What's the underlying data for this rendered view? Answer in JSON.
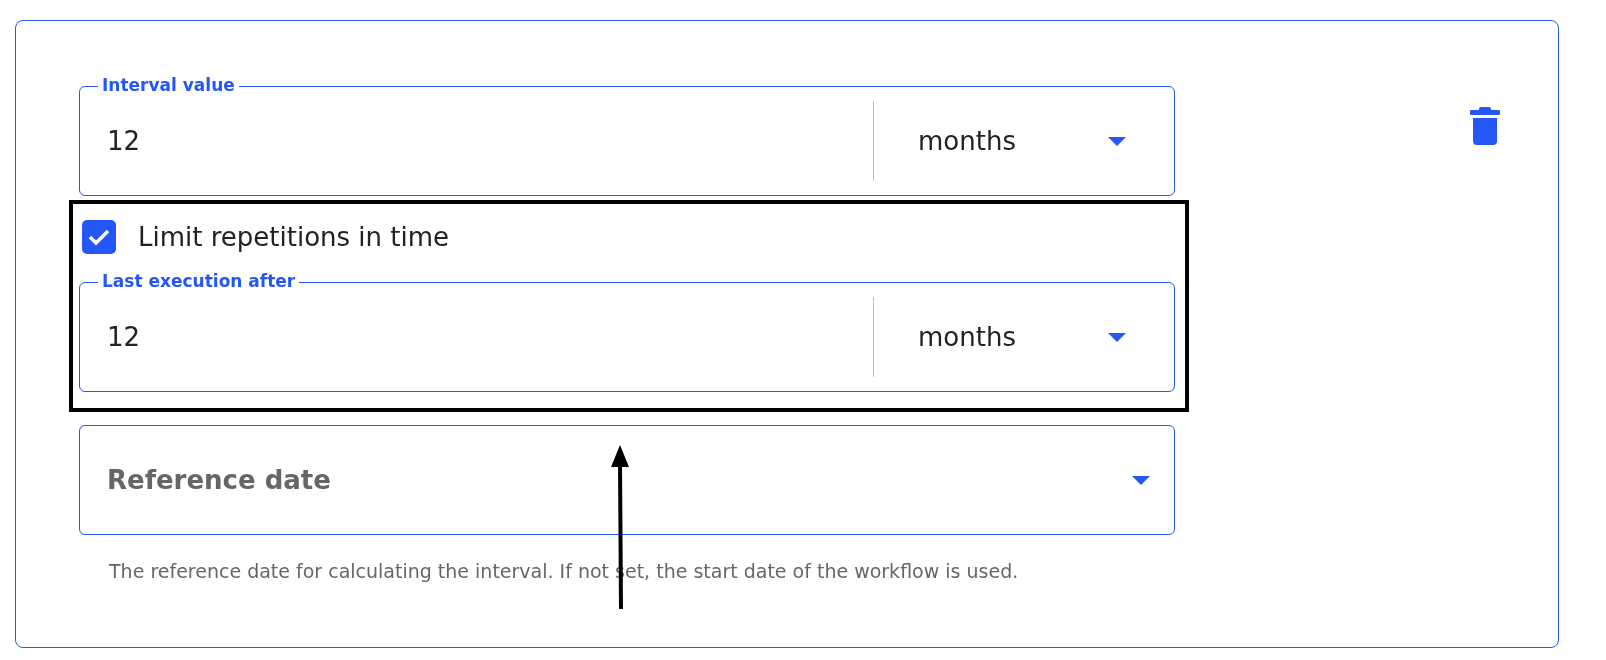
{
  "interval": {
    "label": "Interval value",
    "value": "12",
    "unit": "months"
  },
  "limit_repetitions": {
    "label": "Limit repetitions in time",
    "checked": true
  },
  "last_execution": {
    "label": "Last execution after",
    "value": "12",
    "unit": "months"
  },
  "reference_date": {
    "placeholder": "Reference date",
    "help": "The reference date for calculating the interval. If not set, the start date of the workflow is used."
  }
}
